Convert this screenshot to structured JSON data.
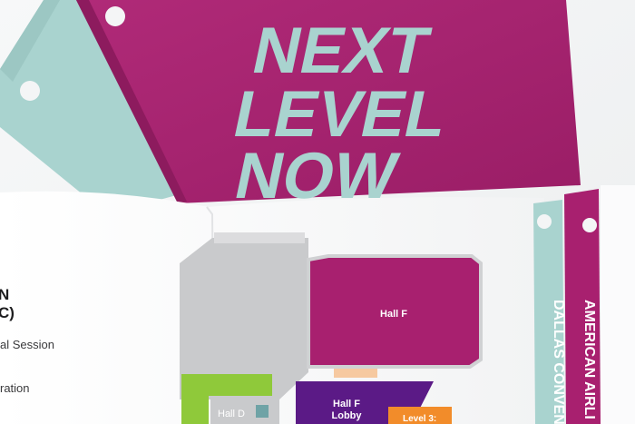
{
  "cover": {
    "line1": "NEXT",
    "line2": "LEVEL",
    "line3": "NOW"
  },
  "map": {
    "hall_f": "Hall F",
    "hall_d": "Hall D",
    "lobby_line1": "Hall F",
    "lobby_line2": "Lobby",
    "level_tag": "Level 3:"
  },
  "left_page": {
    "heading_line1": "N",
    "heading_line2": "C)",
    "item1": "al Session",
    "item2": "ration"
  },
  "tabs": {
    "tab1": "DALLAS CONVEN",
    "tab2": "AMERICAN AIRLI"
  },
  "colors": {
    "magenta": "#a8206f",
    "mint": "#a9d3cf",
    "purple": "#5b1a86",
    "lime": "#8fc93a",
    "orange": "#f28c2a",
    "gray": "#c9cacc"
  }
}
